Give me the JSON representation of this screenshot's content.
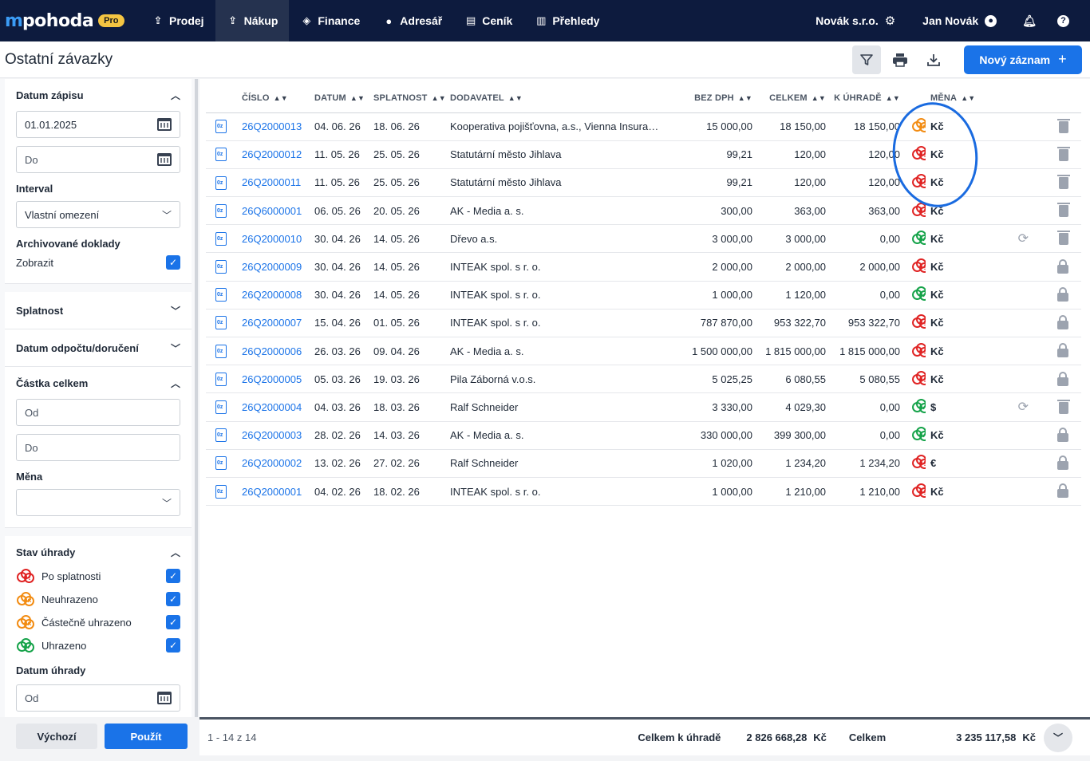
{
  "app": {
    "logo_text": "pohoda",
    "logo_badge": "Pro"
  },
  "nav": [
    {
      "label": "Prodej",
      "icon": "sales-icon",
      "active": false
    },
    {
      "label": "Nákup",
      "icon": "purchase-icon",
      "active": true
    },
    {
      "label": "Finance",
      "icon": "finance-icon",
      "active": false
    },
    {
      "label": "Adresář",
      "icon": "person-icon",
      "active": false
    },
    {
      "label": "Ceník",
      "icon": "clipboard-icon",
      "active": false
    },
    {
      "label": "Přehledy",
      "icon": "bar-chart-icon",
      "active": false
    }
  ],
  "top_right": {
    "company": "Novák s.r.o.",
    "user": "Jan Novák"
  },
  "page": {
    "title": "Ostatní závazky",
    "new_button": "Nový záznam"
  },
  "sidebar": {
    "datum_zapisu": {
      "title": "Datum zápisu",
      "from_value": "01.01.2025",
      "to_placeholder": "Do"
    },
    "interval": {
      "label": "Interval",
      "value": "Vlastní omezení"
    },
    "archived": {
      "label": "Archivované doklady",
      "option": "Zobrazit",
      "checked": true
    },
    "splatnost": {
      "title": "Splatnost"
    },
    "datum_odpoctu": {
      "title": "Datum odpočtu/doručení"
    },
    "castka": {
      "title": "Částka celkem",
      "from_placeholder": "Od",
      "to_placeholder": "Do"
    },
    "mena": {
      "label": "Měna",
      "value": ""
    },
    "stav": {
      "title": "Stav úhrady",
      "items": [
        {
          "label": "Po splatnosti",
          "status": "red",
          "checked": true
        },
        {
          "label": "Neuhrazeno",
          "status": "orange",
          "checked": true
        },
        {
          "label": "Částečně uhrazeno",
          "status": "orange",
          "checked": true
        },
        {
          "label": "Uhrazeno",
          "status": "green",
          "checked": true
        }
      ]
    },
    "datum_uhrady": {
      "title": "Datum úhrady",
      "from_placeholder": "Od"
    },
    "buttons": {
      "default": "Výchozí",
      "apply": "Použít"
    }
  },
  "table": {
    "columns": [
      "ČÍSLO",
      "DATUM",
      "SPLATNOST",
      "DODAVATEL",
      "BEZ DPH",
      "CELKEM",
      "K ÚHRADĚ",
      "MĚNA"
    ],
    "rows": [
      {
        "cislo": "26Q2000013",
        "datum": "04. 06. 26",
        "splatnost": "18. 06. 26",
        "dodavatel": "Kooperativa pojišťovna, a.s., Vienna Insurance Group",
        "bez_dph": "15 000,00",
        "celkem": "18 150,00",
        "k_uhrade": "18 150,00",
        "status": "orange",
        "mena": "Kč",
        "recur": false,
        "action": "trash"
      },
      {
        "cislo": "26Q2000012",
        "datum": "11. 05. 26",
        "splatnost": "25. 05. 26",
        "dodavatel": "Statutární město Jihlava",
        "bez_dph": "99,21",
        "celkem": "120,00",
        "k_uhrade": "120,00",
        "status": "red",
        "mena": "Kč",
        "recur": false,
        "action": "trash"
      },
      {
        "cislo": "26Q2000011",
        "datum": "11. 05. 26",
        "splatnost": "25. 05. 26",
        "dodavatel": "Statutární město Jihlava",
        "bez_dph": "99,21",
        "celkem": "120,00",
        "k_uhrade": "120,00",
        "status": "red",
        "mena": "Kč",
        "recur": false,
        "action": "trash"
      },
      {
        "cislo": "26Q6000001",
        "datum": "06. 05. 26",
        "splatnost": "20. 05. 26",
        "dodavatel": "AK - Media a. s.",
        "bez_dph": "300,00",
        "celkem": "363,00",
        "k_uhrade": "363,00",
        "status": "red",
        "mena": "Kč",
        "recur": false,
        "action": "trash"
      },
      {
        "cislo": "26Q2000010",
        "datum": "30. 04. 26",
        "splatnost": "14. 05. 26",
        "dodavatel": "Dřevo a.s.",
        "bez_dph": "3 000,00",
        "celkem": "3 000,00",
        "k_uhrade": "0,00",
        "status": "green",
        "mena": "Kč",
        "recur": true,
        "action": "trash"
      },
      {
        "cislo": "26Q2000009",
        "datum": "30. 04. 26",
        "splatnost": "14. 05. 26",
        "dodavatel": "INTEAK spol. s r. o.",
        "bez_dph": "2 000,00",
        "celkem": "2 000,00",
        "k_uhrade": "2 000,00",
        "status": "red",
        "mena": "Kč",
        "recur": false,
        "action": "lock"
      },
      {
        "cislo": "26Q2000008",
        "datum": "30. 04. 26",
        "splatnost": "14. 05. 26",
        "dodavatel": "INTEAK spol. s r. o.",
        "bez_dph": "1 000,00",
        "celkem": "1 120,00",
        "k_uhrade": "0,00",
        "status": "green",
        "mena": "Kč",
        "recur": false,
        "action": "lock"
      },
      {
        "cislo": "26Q2000007",
        "datum": "15. 04. 26",
        "splatnost": "01. 05. 26",
        "dodavatel": "INTEAK spol. s r. o.",
        "bez_dph": "787 870,00",
        "celkem": "953 322,70",
        "k_uhrade": "953 322,70",
        "status": "red",
        "mena": "Kč",
        "recur": false,
        "action": "lock"
      },
      {
        "cislo": "26Q2000006",
        "datum": "26. 03. 26",
        "splatnost": "09. 04. 26",
        "dodavatel": "AK - Media a. s.",
        "bez_dph": "1 500 000,00",
        "celkem": "1 815 000,00",
        "k_uhrade": "1 815 000,00",
        "status": "red",
        "mena": "Kč",
        "recur": false,
        "action": "lock"
      },
      {
        "cislo": "26Q2000005",
        "datum": "05. 03. 26",
        "splatnost": "19. 03. 26",
        "dodavatel": "Pila Záborná v.o.s.",
        "bez_dph": "5 025,25",
        "celkem": "6 080,55",
        "k_uhrade": "5 080,55",
        "status": "red",
        "mena": "Kč",
        "recur": false,
        "action": "lock"
      },
      {
        "cislo": "26Q2000004",
        "datum": "04. 03. 26",
        "splatnost": "18. 03. 26",
        "dodavatel": "Ralf Schneider",
        "bez_dph": "3 330,00",
        "celkem": "4 029,30",
        "k_uhrade": "0,00",
        "status": "green",
        "mena": "$",
        "recur": true,
        "action": "trash"
      },
      {
        "cislo": "26Q2000003",
        "datum": "28. 02. 26",
        "splatnost": "14. 03. 26",
        "dodavatel": "AK - Media a. s.",
        "bez_dph": "330 000,00",
        "celkem": "399 300,00",
        "k_uhrade": "0,00",
        "status": "green",
        "mena": "Kč",
        "recur": false,
        "action": "lock"
      },
      {
        "cislo": "26Q2000002",
        "datum": "13. 02. 26",
        "splatnost": "27. 02. 26",
        "dodavatel": "Ralf Schneider",
        "bez_dph": "1 020,00",
        "celkem": "1 234,20",
        "k_uhrade": "1 234,20",
        "status": "red",
        "mena": "€",
        "recur": false,
        "action": "lock"
      },
      {
        "cislo": "26Q2000001",
        "datum": "04. 02. 26",
        "splatnost": "18. 02. 26",
        "dodavatel": "INTEAK spol. s r. o.",
        "bez_dph": "1 000,00",
        "celkem": "1 210,00",
        "k_uhrade": "1 210,00",
        "status": "red",
        "mena": "Kč",
        "recur": false,
        "action": "lock"
      }
    ]
  },
  "footer": {
    "range": "1 - 14 z 14",
    "k_uhrade_label": "Celkem k úhradě",
    "k_uhrade_value": "2 826 668,28",
    "k_uhrade_cur": "Kč",
    "celkem_label": "Celkem",
    "celkem_value": "3 235 117,58",
    "celkem_cur": "Kč"
  },
  "colors": {
    "nav_bg": "#0d1b3e",
    "accent": "#1a73e8",
    "overdue": "#e02424",
    "unpaid": "#f28c13",
    "paid": "#16a34a"
  }
}
